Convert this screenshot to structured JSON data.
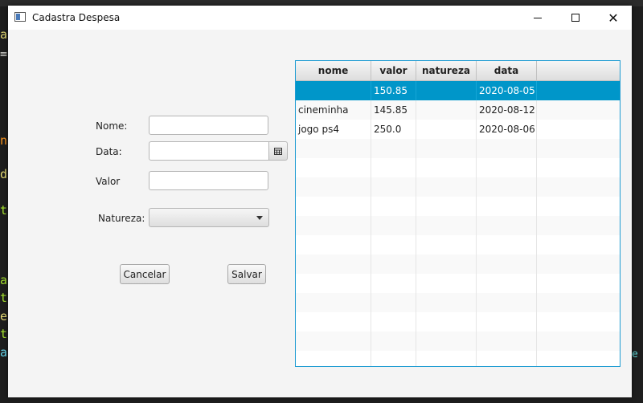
{
  "window": {
    "title": "Cadastra Despesa",
    "minimize_icon": "minimize-icon",
    "maximize_icon": "maximize-icon",
    "close_icon": "close-icon",
    "close_glyph": "✕"
  },
  "form": {
    "nome_label": "Nome:",
    "nome_value": "",
    "data_label": "Data:",
    "data_value": "",
    "data_icon": "calendar-icon",
    "valor_label": "Valor",
    "valor_value": "",
    "natureza_label": "Natureza:",
    "natureza_value": ""
  },
  "buttons": {
    "cancel_label": "Cancelar",
    "save_label": "Salvar"
  },
  "table": {
    "columns": [
      "nome",
      "valor",
      "natureza",
      "data"
    ],
    "rows": [
      {
        "nome": "",
        "valor": "150.85",
        "natureza": "",
        "data": "2020-08-05",
        "selected": true
      },
      {
        "nome": "cineminha",
        "valor": "145.85",
        "natureza": "",
        "data": "2020-08-12",
        "selected": false
      },
      {
        "nome": "jogo ps4",
        "valor": "250.0",
        "natureza": "",
        "data": "2020-08-06",
        "selected": false
      }
    ],
    "selection_color": "#0096c9",
    "border_color": "#1c9bd2"
  },
  "background_editor": {
    "left_chars": [
      {
        "char": "a",
        "color": "#e6db74"
      },
      {
        "char": "=",
        "color": "#f8f8f2"
      },
      {
        "char": "n",
        "color": "#fd971f"
      },
      {
        "char": "d",
        "color": "#e6db74"
      },
      {
        "char": "t",
        "color": "#a6e22e"
      },
      {
        "char": "a",
        "color": "#a6e22e"
      },
      {
        "char": "t",
        "color": "#a6e22e"
      },
      {
        "char": "e",
        "color": "#e6db74"
      },
      {
        "char": "t",
        "color": "#a6e22e"
      },
      {
        "char": "a",
        "color": "#66d9ef"
      }
    ],
    "right_text": "e"
  }
}
